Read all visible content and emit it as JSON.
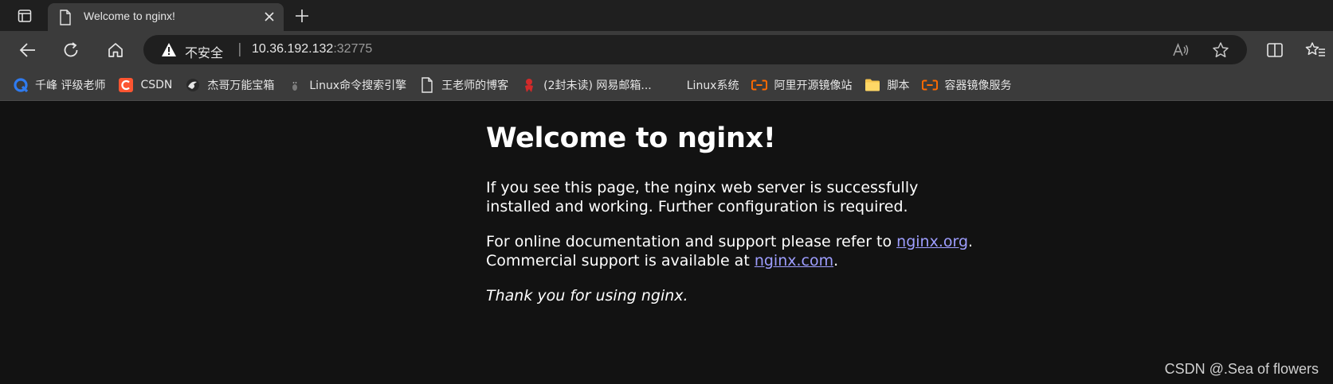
{
  "browser": {
    "tab": {
      "title": "Welcome to nginx!"
    },
    "address_bar": {
      "security_label": "不安全",
      "separator": "|",
      "host": "10.36.192.132",
      "port": ":32775"
    },
    "bookmarks": [
      {
        "label": "千峰 评级老师",
        "icon": "qianfeng-icon"
      },
      {
        "label": "CSDN",
        "icon": "csdn-icon"
      },
      {
        "label": "杰哥万能宝箱",
        "icon": "bird-icon"
      },
      {
        "label": "Linux命令搜索引擎",
        "icon": "linux-tux-icon"
      },
      {
        "label": "王老师的博客",
        "icon": "page-icon"
      },
      {
        "label": "(2封未读) 网易邮箱...",
        "icon": "netease-mail-icon"
      },
      {
        "label": "Linux系统",
        "icon": "blank-icon"
      },
      {
        "label": "阿里开源镜像站",
        "icon": "aliyun-icon"
      },
      {
        "label": "脚本",
        "icon": "folder-icon"
      },
      {
        "label": "容器镜像服务",
        "icon": "aliyun-icon"
      }
    ]
  },
  "page": {
    "heading": "Welcome to nginx!",
    "para1": "If you see this page, the nginx web server is successfully installed and working. Further configuration is required.",
    "para2_prefix": "For online documentation and support please refer to ",
    "link_org": "nginx.org",
    "para2_mid": ".",
    "para2_line2": "Commercial support is available at ",
    "link_com": "nginx.com",
    "para2_end": ".",
    "thanks": "Thank you for using nginx."
  },
  "watermark": "CSDN @.Sea of flowers",
  "colors": {
    "link": "#9e9eff",
    "page_bg": "#121212",
    "toolbar_bg": "#3b3b3b"
  }
}
